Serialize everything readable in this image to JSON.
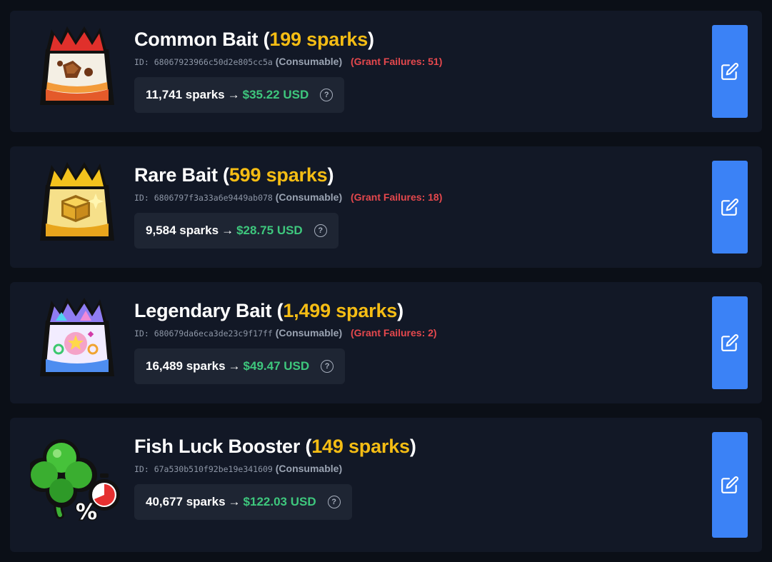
{
  "items": [
    {
      "name": "Common Bait",
      "price": "199 sparks",
      "id_label": "ID: 68067923966c50d2e805cc5a",
      "type": "(Consumable)",
      "grant_failures": "(Grant Failures: 51)",
      "sparks_total": "11,741 sparks",
      "arrow": "→",
      "usd": "$35.22 USD",
      "help_glyph": "?",
      "icon": "bait-bag-red-icon"
    },
    {
      "name": "Rare Bait",
      "price": "599 sparks",
      "id_label": "ID: 6806797f3a33a6e9449ab078",
      "type": "(Consumable)",
      "grant_failures": "(Grant Failures: 18)",
      "sparks_total": "9,584 sparks",
      "arrow": "→",
      "usd": "$28.75 USD",
      "help_glyph": "?",
      "icon": "bait-bag-gold-icon"
    },
    {
      "name": "Legendary Bait",
      "price": "1,499 sparks",
      "id_label": "ID: 680679da6eca3de23c9f17ff",
      "type": "(Consumable)",
      "grant_failures": "(Grant Failures: 2)",
      "sparks_total": "16,489 sparks",
      "arrow": "→",
      "usd": "$49.47 USD",
      "help_glyph": "?",
      "icon": "bait-bag-rainbow-icon"
    },
    {
      "name": "Fish Luck Booster",
      "price": "149 sparks",
      "id_label": "ID: 67a530b510f92be19e341609",
      "type": "(Consumable)",
      "grant_failures": "",
      "sparks_total": "40,677 sparks",
      "arrow": "→",
      "usd": "$122.03 USD",
      "help_glyph": "?",
      "icon": "clover-luck-booster-icon"
    }
  ],
  "colors": {
    "background": "#0b0f17",
    "card": "#121826",
    "price": "#f5bd14",
    "failures": "#e5484d",
    "usd": "#3ec77d",
    "edit_button": "#3b82f6"
  }
}
